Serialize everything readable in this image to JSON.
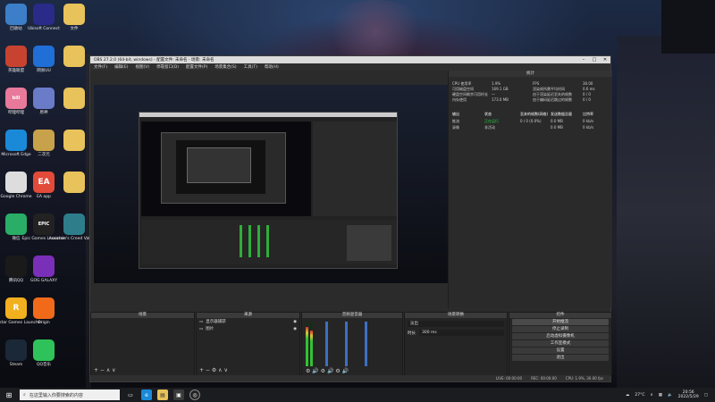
{
  "desktop": {
    "icons_col1": [
      {
        "label": "回收站",
        "icon": "recycle-bin-icon",
        "color": "#3c7fc8"
      },
      {
        "label": "英雄联盟",
        "icon": "league-icon",
        "color": "#c8432f"
      },
      {
        "label": "哔哩哔哩",
        "icon": "bilibili-icon",
        "color": "#e8799a",
        "glyph": "bili"
      },
      {
        "label": "Microsoft Edge",
        "icon": "edge-icon",
        "color": "#1a8ad8"
      },
      {
        "label": "Google Chrome",
        "icon": "chrome-icon",
        "color": "#dddddd"
      },
      {
        "label": "微信",
        "icon": "wechat-icon",
        "color": "#2aae67"
      },
      {
        "label": "腾讯QQ",
        "icon": "qq-icon",
        "color": "#1a1a1a"
      },
      {
        "label": "Rockstar Games Launcher",
        "icon": "rockstar-icon",
        "color": "#f2b01e",
        "glyph": "R"
      },
      {
        "label": "Steam",
        "icon": "steam-icon",
        "color": "#1b2838"
      }
    ],
    "icons_col2": [
      {
        "label": "Ubisoft Connect",
        "icon": "ubisoft-icon",
        "color": "#2a2a88"
      },
      {
        "label": "网易UU",
        "icon": "network-icon",
        "color": "#1f6fd6"
      },
      {
        "label": "原神",
        "icon": "genshin-icon",
        "color": "#6a7bc8"
      },
      {
        "label": "二次元",
        "icon": "game-icon",
        "color": "#c8a24a"
      },
      {
        "label": "EA app",
        "icon": "ea-icon",
        "color": "#e24a3a",
        "glyph": "EA"
      },
      {
        "label": "Epic Games Launcher",
        "icon": "epic-icon",
        "color": "#222222",
        "glyph": "EPIC"
      },
      {
        "label": "GOG GALAXY",
        "icon": "gog-icon",
        "color": "#7a2fb8"
      },
      {
        "label": "Origin",
        "icon": "origin-icon",
        "color": "#f06a1a"
      },
      {
        "label": "QQ音乐",
        "icon": "music-icon",
        "color": "#2fc25a"
      }
    ],
    "icons_col3": [
      {
        "label": "文件",
        "icon": "folder-icon",
        "color": "#e8c25a"
      },
      {
        "label": "",
        "icon": "folder-icon",
        "color": "#e8c25a"
      },
      {
        "label": "",
        "icon": "folder-icon",
        "color": "#e8c25a"
      },
      {
        "label": "",
        "icon": "folder-icon",
        "color": "#e8c25a"
      },
      {
        "label": "",
        "icon": "folder-icon",
        "color": "#e8c25a"
      },
      {
        "label": "Assassin's Creed Valhalla",
        "icon": "ac-icon",
        "color": "#2e7d8a"
      }
    ]
  },
  "obs": {
    "title": "OBS 27.2.0 (64-bit, windows) - 配置文件: 未命名 - 场景: 未命名",
    "menu": [
      "文件(F)",
      "编辑(E)",
      "视图(V)",
      "停靠窗口(D)",
      "配置文件(P)",
      "场景集合(S)",
      "工具(T)",
      "帮助(H)"
    ],
    "stats": {
      "title": "统计",
      "rows": [
        {
          "k": "CPU 使用率",
          "v": "1.9%",
          "k2": "FPS",
          "v2": "30.00"
        },
        {
          "k": "可用磁盘空间",
          "v": "169.1 GB",
          "k2": "渲染帧所需平均时间",
          "v2": "0.6 ms"
        },
        {
          "k": "硬盘空间剩余可用时长",
          "v": "—",
          "k2": "由于渲染延迟丢失的帧数",
          "v2": "0 / 0"
        },
        {
          "k": "内存使用",
          "v": "173.0 MB",
          "k2": "由于编码延迟跳过的帧数",
          "v2": "0 / 0"
        }
      ],
      "table_headers": [
        "输出",
        "状态",
        "丢弃的帧数(网络)",
        "发送数据总量",
        "比特率"
      ],
      "table_rows": [
        {
          "name": "推流",
          "status": "正在运行",
          "status_color": "#2ecc40",
          "dropped": "0 / 0 (0.0%)",
          "sent": "0.0 MB",
          "bitrate": "0 kb/s"
        },
        {
          "name": "录像",
          "status": "非活动",
          "status_color": "#cfcfcf",
          "dropped": "",
          "sent": "0.0 MB",
          "bitrate": "0 kb/s"
        }
      ],
      "reset_button": "重置"
    },
    "docks": {
      "scenes": "场景",
      "sources": "来源",
      "mixer": "音频混音器",
      "transitions": "场景转换",
      "controls": "控件"
    },
    "source_items": [
      "显示器捕获",
      "图片"
    ],
    "transition": {
      "type": "淡出",
      "duration_label": "时长",
      "duration_value": "300 ms"
    },
    "controls": [
      "开始推流",
      "停止录制",
      "启动虚拟摄像机",
      "工作室模式",
      "设置",
      "退出"
    ],
    "status_bar": [
      "LIVE: 00:00:00",
      "REC: 00:00:00",
      "CPU: 1.9%, 30.00 fps"
    ]
  },
  "taskbar": {
    "search_placeholder": "在这里输入你要搜索的内容",
    "tray_weather": "27°C",
    "time": "20:56",
    "date": "2022/5/29"
  }
}
